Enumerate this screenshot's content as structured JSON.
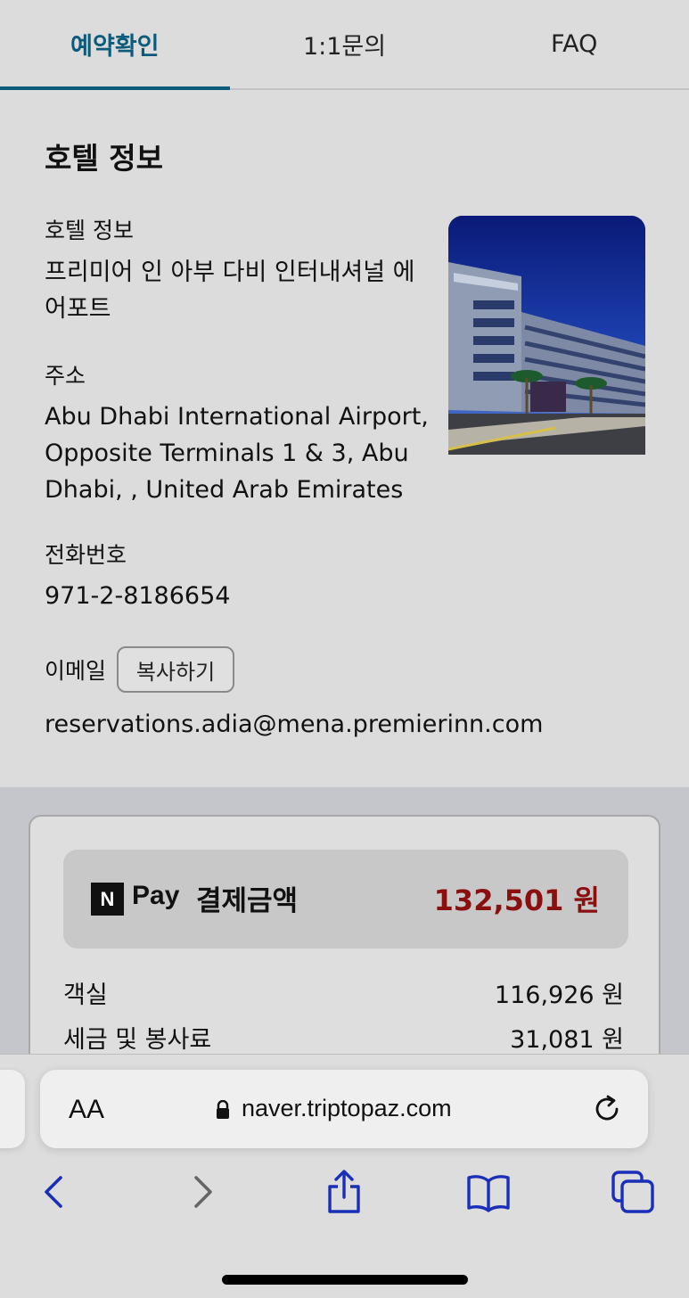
{
  "tabs": [
    {
      "label": "예약확인",
      "active": true
    },
    {
      "label": "1:1문의",
      "active": false
    },
    {
      "label": "FAQ",
      "active": false
    }
  ],
  "hotel_section": {
    "title": "호텔 정보",
    "name_label": "호텔 정보",
    "name_lines": [
      "프리미어 인 아부 다비 인터내셔널 에",
      "어포트"
    ],
    "address_label": "주소",
    "address_lines": [
      "Abu Dhabi International Airport,",
      "Opposite Terminals 1 & 3, Abu",
      "Dhabi, , United Arab Emirates"
    ],
    "phone_label": "전화번호",
    "phone": "971-2-8186654",
    "email_label": "이메일",
    "copy_button": "복사하기",
    "email": "reservations.adia@mena.premierinn.com"
  },
  "payment": {
    "npay_logo": "N",
    "npay_text": "Pay",
    "label": "결제금액",
    "amount": "132,501 원",
    "amount_color": "#8a1010",
    "rows": [
      {
        "label": "객실",
        "value": "116,926 원"
      },
      {
        "label": "세금 및 봉사료",
        "value": "31,081 원"
      }
    ]
  },
  "browser": {
    "text_size_button": "AA",
    "url": "naver.triptopaz.com",
    "accent_color": "#1a2fb8",
    "nav_icons": [
      "back-icon",
      "forward-icon",
      "share-icon",
      "bookmarks-icon",
      "tabs-icon"
    ]
  }
}
